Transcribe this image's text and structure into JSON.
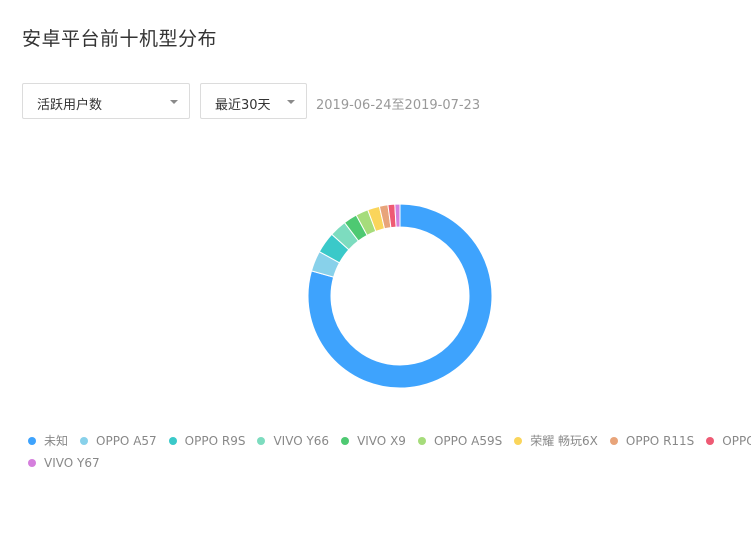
{
  "page": {
    "title": "安卓平台前十机型分布",
    "metric_select": {
      "value": "活跃用户数"
    },
    "range_select": {
      "value": "最近30天"
    },
    "date_range": "2019-06-24至2019-07-23"
  },
  "chart_data": {
    "type": "pie",
    "variant": "donut",
    "title": "",
    "legend_position": "bottom",
    "categories": [
      "未知",
      "OPPO A57",
      "OPPO R9S",
      "VIVO Y66",
      "VIVO X9",
      "OPPO A59S",
      "荣耀 畅玩6X",
      "OPPO R11S",
      "OPPO",
      "VIVO Y67"
    ],
    "values": [
      79.4,
      3.6,
      3.7,
      3.0,
      2.4,
      2.2,
      2.1,
      1.5,
      1.2,
      0.9
    ],
    "colors": [
      "#3ea3fd",
      "#88d1ea",
      "#3ac9c9",
      "#7ddcbf",
      "#4ec972",
      "#a6dc7b",
      "#fad55b",
      "#e8a47a",
      "#ee5a74",
      "#d57fdd"
    ]
  }
}
